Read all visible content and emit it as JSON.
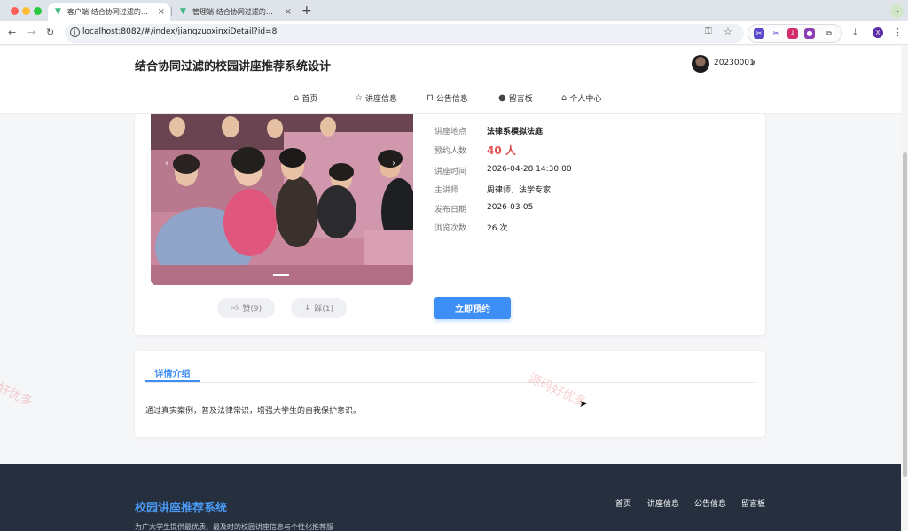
{
  "browser": {
    "tabs": [
      {
        "title": "客户端-结合协同过滤的校园讲座推荐系统设计",
        "active": true
      },
      {
        "title": "管理端-结合协同过滤的校园讲座推荐系统设计",
        "active": false
      }
    ],
    "url": "localhost:8082/#/index/jiangzuoxinxiDetail?id=8",
    "profile_initial": "X"
  },
  "header": {
    "site_title": "结合协同过滤的校园讲座推荐系统设计",
    "username": "20230001"
  },
  "nav": {
    "items": [
      {
        "label": "首页",
        "icon": "home-icon"
      },
      {
        "label": "讲座信息",
        "icon": "star-icon"
      },
      {
        "label": "公告信息",
        "icon": "bag-icon"
      },
      {
        "label": "留言板",
        "icon": "info-icon"
      },
      {
        "label": "个人中心",
        "icon": "house-icon"
      }
    ]
  },
  "lecture": {
    "fields": [
      {
        "label": "讲座地点",
        "value": "法律系模拟法庭"
      },
      {
        "label": "预约人数",
        "value": "40 人"
      },
      {
        "label": "讲座时间",
        "value": "2026-04-28 14:30:00"
      },
      {
        "label": "主讲师",
        "value": "周律师，法学专家"
      },
      {
        "label": "发布日期",
        "value": "2026-03-05"
      },
      {
        "label": "浏览次数",
        "value": "26 次"
      }
    ],
    "like_label": "赞(9)",
    "dislike_label": "踩(1)",
    "reserve_label": "立即预约"
  },
  "detail": {
    "tab_label": "详情介绍",
    "content": "通过真实案例，普及法律常识，增强大学生的自我保护意识。"
  },
  "footer": {
    "title": "校园讲座推荐系统",
    "description": "为广大学生提供最优质、最及时的校园讲座信息与个性化推荐服",
    "links": [
      "首页",
      "讲座信息",
      "公告信息",
      "留言板"
    ]
  },
  "watermark": {
    "text_full": "源码好优多",
    "text_partial": "好优多"
  },
  "colors": {
    "accent": "#3d8ef5",
    "highlight_red": "#e05252",
    "footer_bg": "#252f3e"
  }
}
